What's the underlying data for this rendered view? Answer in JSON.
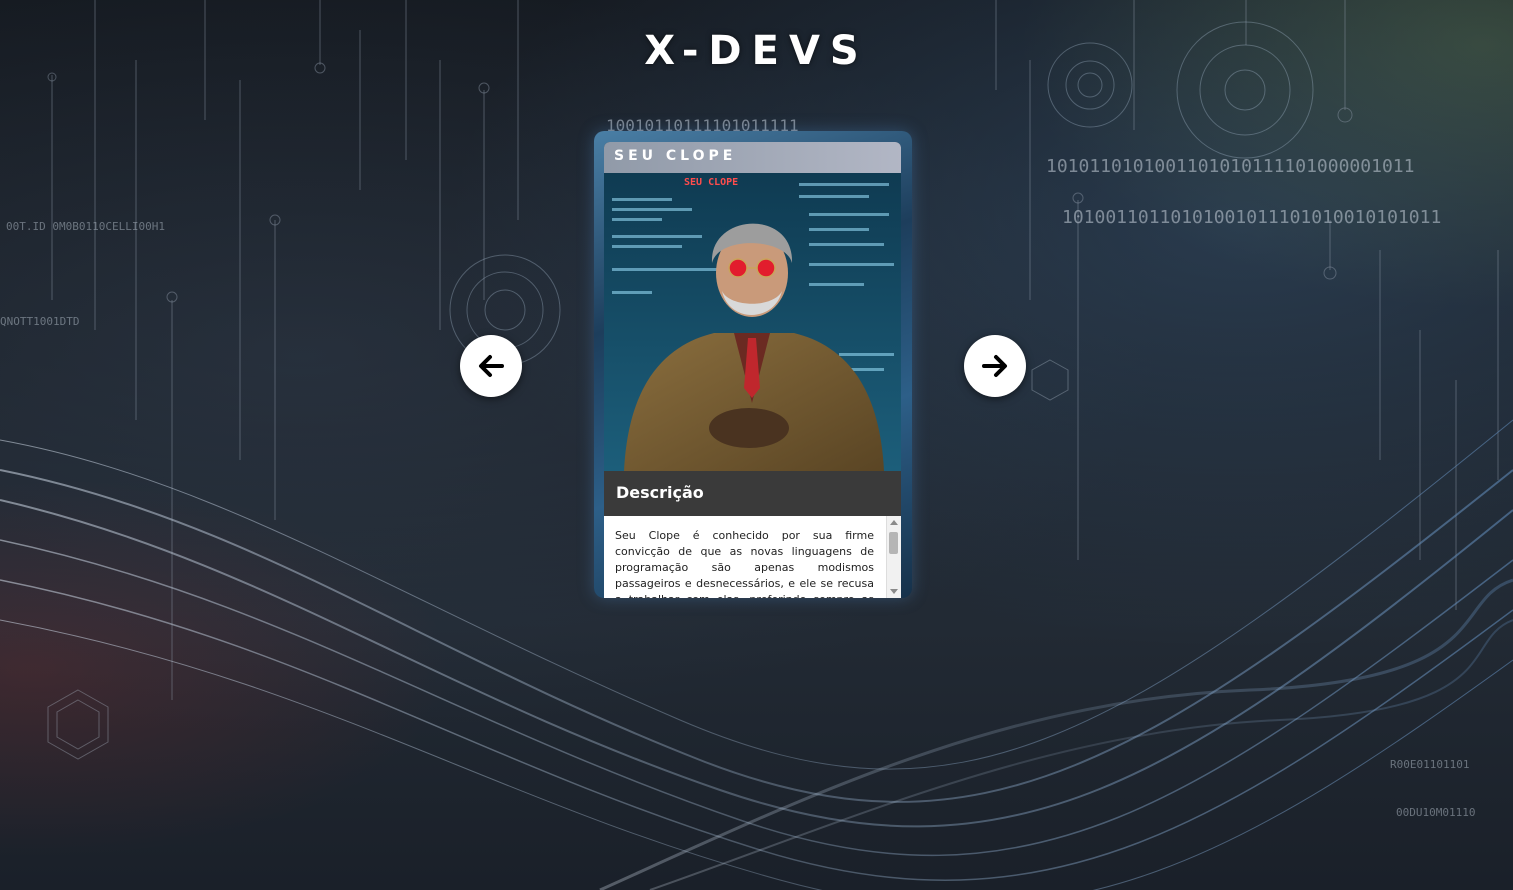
{
  "app": {
    "title": "X-DEVS"
  },
  "carousel": {
    "prev_icon": "arrow-left-icon",
    "next_icon": "arrow-right-icon"
  },
  "card": {
    "name": "SEU CLOPE",
    "portrait_sign": "SEU CLOPE",
    "description_title": "Descrição",
    "description_text": "Seu Clope é conhecido por sua firme convicção de que as novas linguagens de programação são apenas modismos passageiros e desnecessários, e ele se recusa a trabalhar com elas, preferindo sempre as antigas."
  },
  "colors": {
    "card_frame": "#2d5f88",
    "name_bar": "#a9b0c0",
    "desc_header": "#3a3a3a",
    "nav_button": "#ffffff"
  }
}
